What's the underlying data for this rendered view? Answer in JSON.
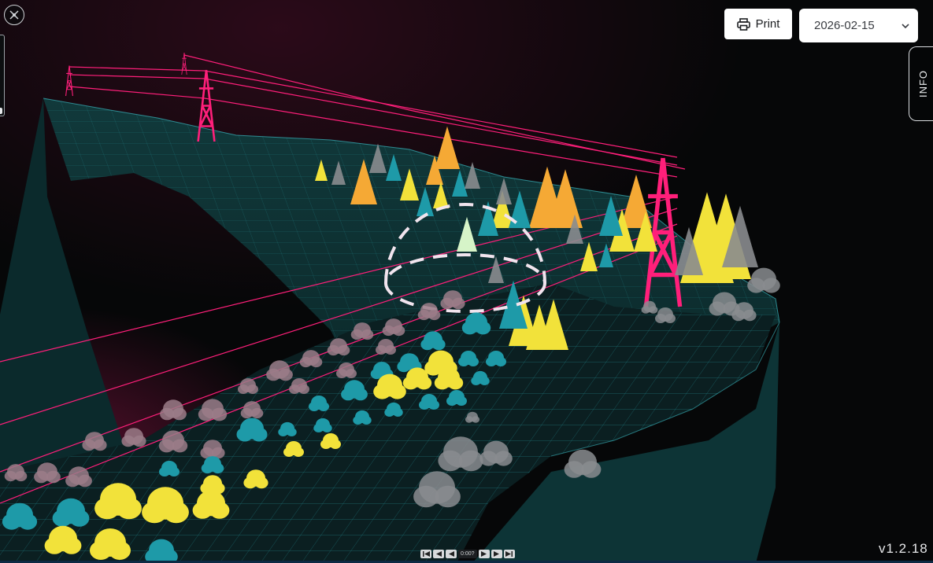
{
  "toolbar": {
    "print_label": "Print",
    "date_value": "2026-02-15"
  },
  "info_tab": {
    "label": "INFO"
  },
  "version": "v1.2.18",
  "timeline": {
    "time_label": "0:00?",
    "buttons": [
      "skip-start",
      "step-back",
      "play-back",
      "play",
      "step-forward",
      "skip-end"
    ]
  },
  "colors": {
    "background": "#060708",
    "terrain": "#0d3436",
    "grid": "#2ec6d0",
    "power_line": "#ff1f7a",
    "tree_yellow": "#f2e23a",
    "tree_orange": "#f5a935",
    "tree_teal": "#1e9aa8",
    "tree_grey": "#8a8c8f",
    "tree_pink_grey": "#9b7d88",
    "selection_dome": "#f1e4ee"
  }
}
